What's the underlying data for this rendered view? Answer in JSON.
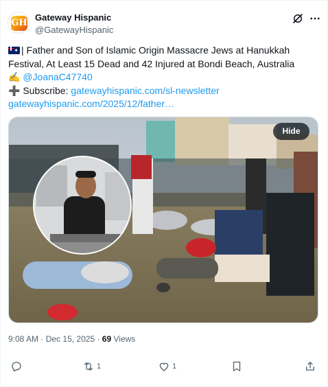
{
  "author": {
    "name": "Gateway Hispanic",
    "handle": "@GatewayHispanic",
    "avatar_letter": "GH"
  },
  "tweet": {
    "line1": "| Father and Son of Islamic Origin Massacre Jews at Hanukkah",
    "line2": "Festival, At Least 15 Dead and 42 Injured at Bondi Beach, Australia",
    "line3_emoji": "✍️",
    "line3_mention": "@JoanaC47740",
    "line4_prefix": "➕ Subscribe: ",
    "line4_link": "gatewayhispanic.com/sl-newsletter",
    "line5_link": "gatewayhispanic.com/2025/12/father…"
  },
  "media": {
    "hide_label": "Hide"
  },
  "meta": {
    "time": "9:08 AM",
    "separator": "·",
    "date": "Dec 15, 2025",
    "views_count": "69",
    "views_label": "Views"
  },
  "actions": {
    "retweets": "1",
    "likes": "1"
  },
  "icons": [
    "grok-icon",
    "more-icon",
    "reply-icon",
    "retweet-icon",
    "like-icon",
    "bookmark-icon",
    "share-icon"
  ],
  "colors": {
    "link": "#1d9bf0",
    "secondary_text": "#536471",
    "primary_text": "#0f1419"
  }
}
